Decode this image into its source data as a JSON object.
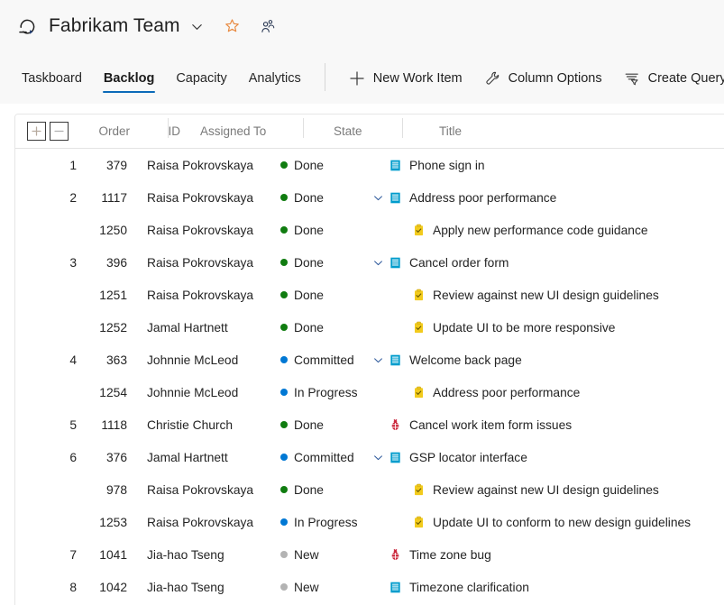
{
  "header": {
    "project_icon": "boards-refresh-icon",
    "title": "Fabrikam Team",
    "chevron": "chevron-down-icon",
    "favorite_icon": "star-icon",
    "team_icon": "people-icon"
  },
  "tabs": [
    {
      "label": "Taskboard",
      "active": false
    },
    {
      "label": "Backlog",
      "active": true
    },
    {
      "label": "Capacity",
      "active": false
    },
    {
      "label": "Analytics",
      "active": false
    }
  ],
  "commands": [
    {
      "label": "New Work Item",
      "icon": "plus-icon"
    },
    {
      "label": "Column Options",
      "icon": "wrench-icon"
    },
    {
      "label": "Create Query",
      "icon": "filter-icon"
    }
  ],
  "grid": {
    "expand_all_icon": "plus-box-icon",
    "collapse_all_icon": "minus-box-icon",
    "columns": [
      "Order",
      "ID",
      "Assigned To",
      "State",
      "Title"
    ],
    "rows": [
      {
        "order": "1",
        "id": "379",
        "assigned": "Raisa Pokrovskaya",
        "state": "Done",
        "state_color": "#107c10",
        "title": "Phone sign in",
        "type": "backlog-item",
        "expandable": false,
        "child": false
      },
      {
        "order": "2",
        "id": "1117",
        "assigned": "Raisa Pokrovskaya",
        "state": "Done",
        "state_color": "#107c10",
        "title": "Address poor performance",
        "type": "backlog-item",
        "expandable": true,
        "child": false
      },
      {
        "order": "",
        "id": "1250",
        "assigned": "Raisa Pokrovskaya",
        "state": "Done",
        "state_color": "#107c10",
        "title": "Apply new performance code guidance",
        "type": "task",
        "expandable": false,
        "child": true
      },
      {
        "order": "3",
        "id": "396",
        "assigned": "Raisa Pokrovskaya",
        "state": "Done",
        "state_color": "#107c10",
        "title": "Cancel order form",
        "type": "backlog-item",
        "expandable": true,
        "child": false
      },
      {
        "order": "",
        "id": "1251",
        "assigned": "Raisa Pokrovskaya",
        "state": "Done",
        "state_color": "#107c10",
        "title": "Review against new UI design guidelines",
        "type": "task",
        "expandable": false,
        "child": true
      },
      {
        "order": "",
        "id": "1252",
        "assigned": "Jamal Hartnett",
        "state": "Done",
        "state_color": "#107c10",
        "title": "Update UI to be more responsive",
        "type": "task",
        "expandable": false,
        "child": true
      },
      {
        "order": "4",
        "id": "363",
        "assigned": "Johnnie McLeod",
        "state": "Committed",
        "state_color": "#0078d4",
        "title": "Welcome back page",
        "type": "backlog-item",
        "expandable": true,
        "child": false
      },
      {
        "order": "",
        "id": "1254",
        "assigned": "Johnnie McLeod",
        "state": "In Progress",
        "state_color": "#0078d4",
        "title": "Address poor performance",
        "type": "task",
        "expandable": false,
        "child": true
      },
      {
        "order": "5",
        "id": "1118",
        "assigned": "Christie Church",
        "state": "Done",
        "state_color": "#107c10",
        "title": "Cancel work item form issues",
        "type": "bug",
        "expandable": false,
        "child": false
      },
      {
        "order": "6",
        "id": "376",
        "assigned": "Jamal Hartnett",
        "state": "Committed",
        "state_color": "#0078d4",
        "title": "GSP locator interface",
        "type": "backlog-item",
        "expandable": true,
        "child": false
      },
      {
        "order": "",
        "id": "978",
        "assigned": "Raisa Pokrovskaya",
        "state": "Done",
        "state_color": "#107c10",
        "title": "Review against new UI design guidelines",
        "type": "task",
        "expandable": false,
        "child": true
      },
      {
        "order": "",
        "id": "1253",
        "assigned": "Raisa Pokrovskaya",
        "state": "In Progress",
        "state_color": "#0078d4",
        "title": "Update UI to conform to new design guidelines",
        "type": "task",
        "expandable": false,
        "child": true
      },
      {
        "order": "7",
        "id": "1041",
        "assigned": "Jia-hao Tseng",
        "state": "New",
        "state_color": "#b3b3b3",
        "title": "Time zone bug",
        "type": "bug",
        "expandable": false,
        "child": false
      },
      {
        "order": "8",
        "id": "1042",
        "assigned": "Jia-hao Tseng",
        "state": "New",
        "state_color": "#b3b3b3",
        "title": "Timezone clarification",
        "type": "backlog-item",
        "expandable": false,
        "child": false
      }
    ]
  },
  "colors": {
    "accent": "#0b6ab8",
    "done": "#107c10",
    "active": "#0078d4",
    "new": "#b3b3b3",
    "backlog_item": "#009ccc",
    "task": "#f2cb1d",
    "bug": "#cc293d",
    "star": "#e8873c"
  }
}
